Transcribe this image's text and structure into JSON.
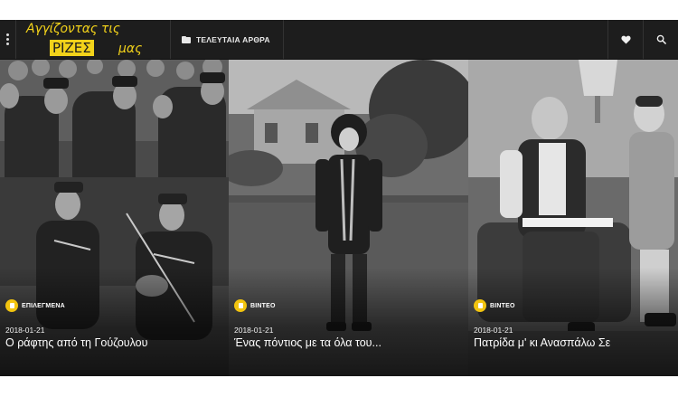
{
  "header": {
    "logo_line1": "Αγγίζοντας τις",
    "logo_line2": "ΡΙΖΕΣ",
    "logo_line3": "μας",
    "nav_latest_label": "ΤΕΛΕΥΤΑΙΑ ΑΡΘΡΑ",
    "icons": [
      "menu-dots-icon",
      "folder-icon",
      "heart-icon",
      "search-icon"
    ],
    "brand_color": "#f2d21a",
    "bar_color": "#1d1d1d"
  },
  "cards": [
    {
      "category": "ΕΠΙΛΕΓΜΕΝΑ",
      "date": "2018-01-21",
      "title": "Ο ράφτης από τη Γούζουλου",
      "icon": "bookmark-icon"
    },
    {
      "category": "ΒΙΝΤΕΟ",
      "date": "2018-01-21",
      "title": "Ένας πόντιος με τα όλα του...",
      "icon": "bookmark-icon"
    },
    {
      "category": "ΒΙΝΤΕΟ",
      "date": "2018-01-21",
      "title": "Πατρίδα μ' κι Ανασπάλω Σε",
      "icon": "bookmark-icon"
    }
  ],
  "category_icon_color": "#f2c40f"
}
